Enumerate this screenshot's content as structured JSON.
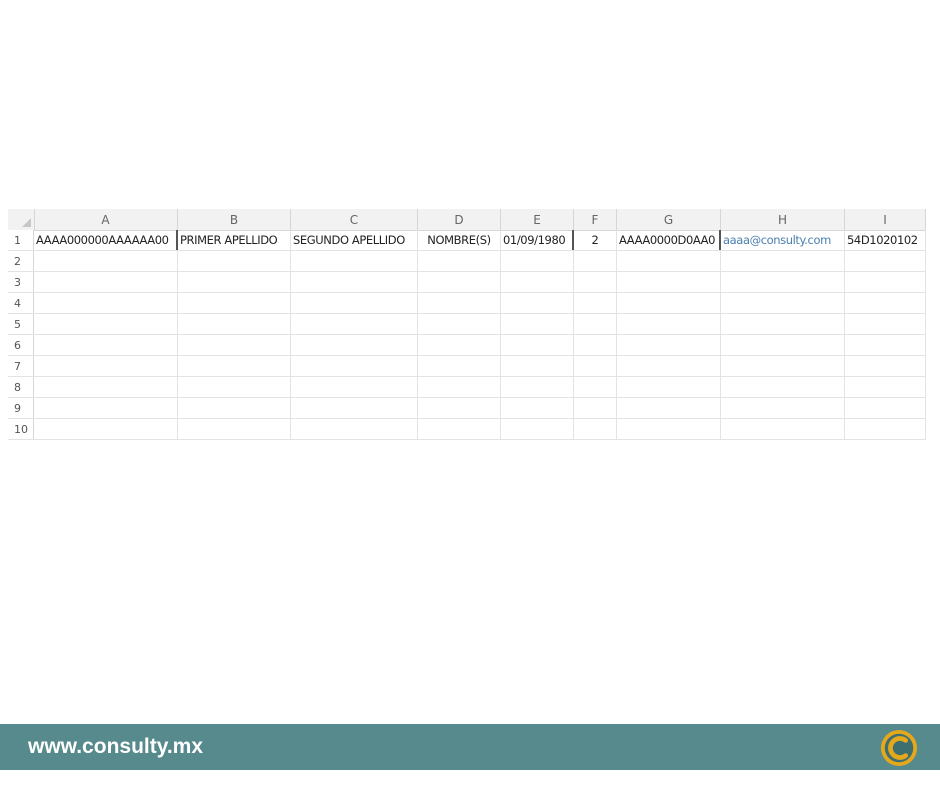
{
  "spreadsheet": {
    "columns": [
      {
        "letter": "A"
      },
      {
        "letter": "B"
      },
      {
        "letter": "C"
      },
      {
        "letter": "D"
      },
      {
        "letter": "E"
      },
      {
        "letter": "F"
      },
      {
        "letter": "G"
      },
      {
        "letter": "H"
      },
      {
        "letter": "I"
      }
    ],
    "rows": [
      "1",
      "2",
      "3",
      "4",
      "5",
      "6",
      "7",
      "8",
      "9",
      "10"
    ],
    "row1": {
      "A": "AAAA000000AAAAAA00",
      "B": "PRIMER APELLIDO",
      "C": "SEGUNDO APELLIDO",
      "D": "NOMBRE(S)",
      "E": "01/09/1980",
      "F": "2",
      "G": "AAAA0000D0AA0",
      "H": "aaaa@consulty.com",
      "I": "54D1020102"
    }
  },
  "footer": {
    "url": "www.consulty.mx",
    "logo": "consulty-logo-icon",
    "color": "#568a8c"
  }
}
